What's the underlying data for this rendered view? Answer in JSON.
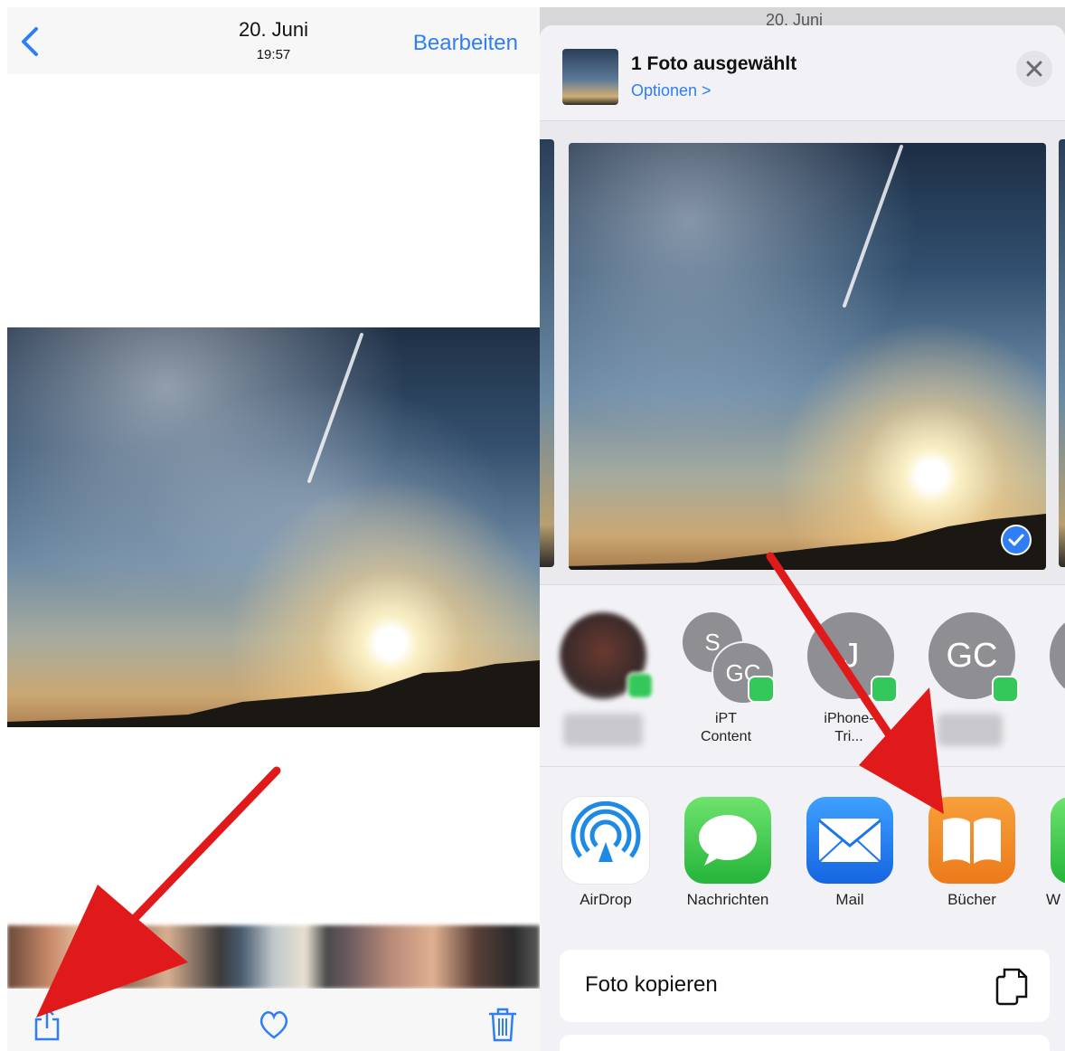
{
  "left_panel": {
    "nav": {
      "date": "20. Juni",
      "time": "19:57",
      "edit_label": "Bearbeiten"
    },
    "toolbar": {
      "icons": [
        "share-icon",
        "heart-icon",
        "trash-icon"
      ]
    }
  },
  "right_panel": {
    "status_peek": "20. Juni",
    "share_sheet": {
      "title": "1 Foto ausgewählt",
      "options_label": "Optionen >",
      "contacts": [
        {
          "initials": "",
          "label": ""
        },
        {
          "initials": "S",
          "initials_2": "GC",
          "label_line1": "iPT",
          "label_line2": "Content"
        },
        {
          "initials": "J",
          "label_line1": "iPhone-",
          "label_line2": "Tri..."
        },
        {
          "initials": "GC",
          "label": ""
        }
      ],
      "apps": [
        {
          "label": "AirDrop",
          "icon": "airdrop-icon"
        },
        {
          "label": "Nachrichten",
          "icon": "messages-icon"
        },
        {
          "label": "Mail",
          "icon": "mail-icon"
        },
        {
          "label": "Bücher",
          "icon": "books-icon"
        },
        {
          "label": "W",
          "icon": "partial-app-icon"
        }
      ],
      "actions": [
        {
          "label": "Foto kopieren",
          "icon": "copy-icon"
        }
      ]
    }
  },
  "colors": {
    "accent": "#2f7ef6",
    "arrow": "#e01a1a",
    "messages_green": "#34c759",
    "books_orange": "#f08a24"
  }
}
